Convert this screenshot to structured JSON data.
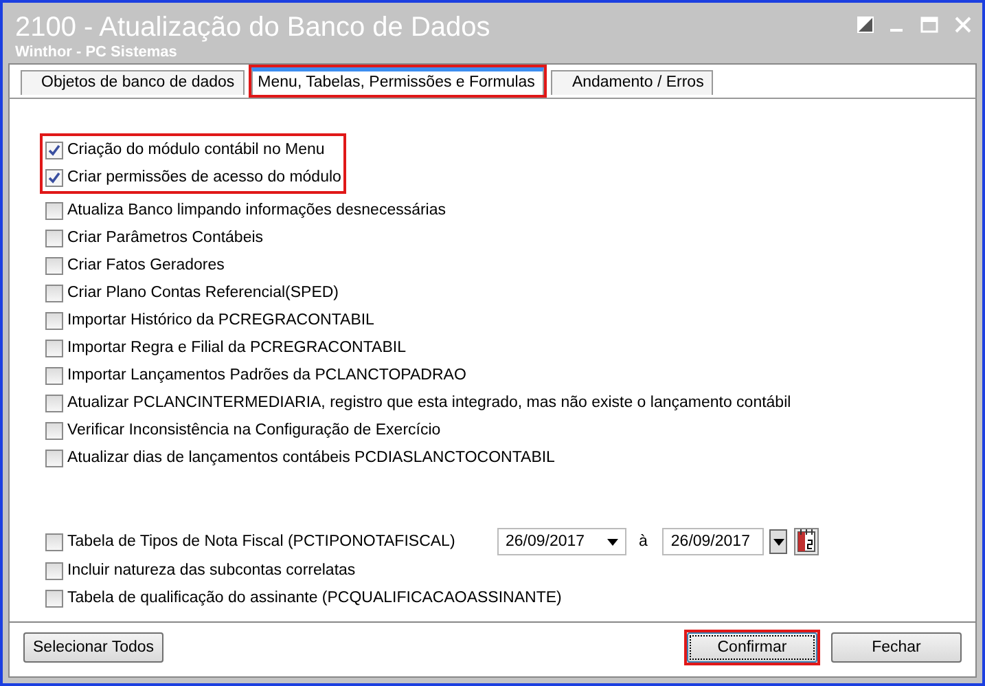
{
  "window": {
    "title": "2100 - Atualização do Banco de Dados",
    "subtitle": "Winthor - PC Sistemas"
  },
  "tabs": [
    {
      "label": "Objetos de banco de dados",
      "selected": false,
      "highlighted": false
    },
    {
      "label": "Menu, Tabelas, Permissões e Formulas",
      "selected": true,
      "highlighted": true
    },
    {
      "label": "Andamento / Erros",
      "selected": false,
      "highlighted": false
    }
  ],
  "options": [
    {
      "label": "Criação do módulo contábil no Menu",
      "checked": true,
      "highlighted": true
    },
    {
      "label": "Criar permissões de acesso do módulo",
      "checked": true,
      "highlighted": true
    },
    {
      "label": "Atualiza Banco limpando informações desnecessárias",
      "checked": false,
      "highlighted": false
    },
    {
      "label": "Criar Parâmetros Contábeis",
      "checked": false,
      "highlighted": false
    },
    {
      "label": "Criar Fatos Geradores",
      "checked": false,
      "highlighted": false
    },
    {
      "label": "Criar Plano Contas Referencial(SPED)",
      "checked": false,
      "highlighted": false
    },
    {
      "label": "Importar Histórico da PCREGRACONTABIL",
      "checked": false,
      "highlighted": false
    },
    {
      "label": "Importar Regra e Filial da PCREGRACONTABIL",
      "checked": false,
      "highlighted": false
    },
    {
      "label": "Importar Lançamentos Padrões da PCLANCTOPADRAO",
      "checked": false,
      "highlighted": false
    },
    {
      "label": "Atualizar PCLANCINTERMEDIARIA, registro que esta integrado, mas não existe o lançamento contábil",
      "checked": false,
      "highlighted": false
    },
    {
      "label": "Verificar Inconsistência na Configuração de Exercício",
      "checked": false,
      "highlighted": false
    },
    {
      "label": "Atualizar dias de lançamentos contábeis PCDIASLANCTOCONTABIL",
      "checked": false,
      "highlighted": false
    }
  ],
  "table_options": [
    {
      "label": "Tabela de Tipos de Nota Fiscal (PCTIPONOTAFISCAL)",
      "checked": false
    },
    {
      "label": "Incluir natureza das subcontas correlatas",
      "checked": false
    },
    {
      "label": "Tabela de qualificação do assinante (PCQUALIFICACAOASSINANTE)",
      "checked": false
    }
  ],
  "date_range": {
    "from": "26/09/2017",
    "separator": "à",
    "to": "26/09/2017"
  },
  "buttons": [
    {
      "label": "Selecionar Todos",
      "highlighted": false
    },
    {
      "label": "Confirmar",
      "highlighted": true
    },
    {
      "label": "Fechar",
      "highlighted": false
    }
  ]
}
